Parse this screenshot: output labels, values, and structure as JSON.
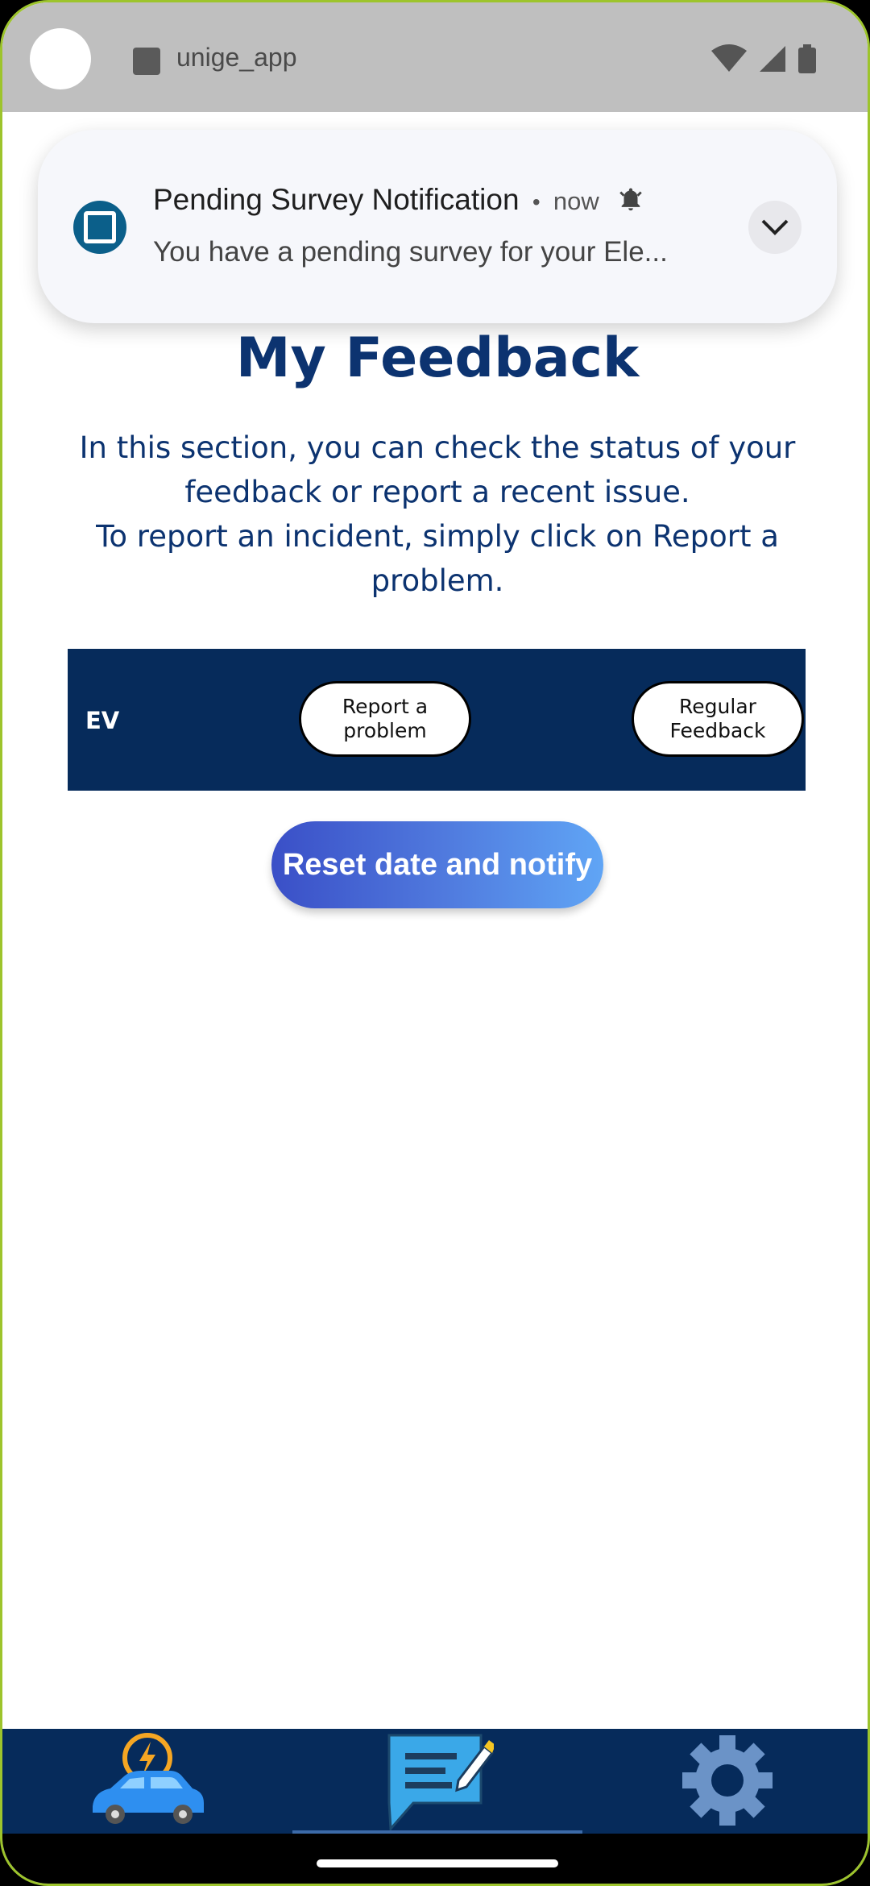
{
  "status_bar": {
    "app_name": "unige_app"
  },
  "notification": {
    "title": "Pending Survey Notification",
    "separator": "•",
    "time": "now",
    "body": "You have a pending survey for your Ele..."
  },
  "page": {
    "title": "My Feedback",
    "intro_line1": "In this section, you can check the status of your feedback or report a recent issue.",
    "intro_line2": "To report an incident, simply click on Report a problem."
  },
  "ev_card": {
    "label": "EV",
    "report_line1": "Report a",
    "report_line2": "problem",
    "regular_line1": "Regular",
    "regular_line2": "Feedback"
  },
  "reset_button": {
    "label": "Reset date and notify"
  },
  "bottom_nav": {
    "items": [
      {
        "icon": "ev-car-icon"
      },
      {
        "icon": "feedback-icon",
        "selected": true
      },
      {
        "icon": "settings-gear-icon"
      }
    ]
  },
  "colors": {
    "primary_navy": "#062b5b",
    "title_blue": "#0c3370",
    "status_bar": "#bfbfbf",
    "notif_icon": "#0b5f8a"
  }
}
